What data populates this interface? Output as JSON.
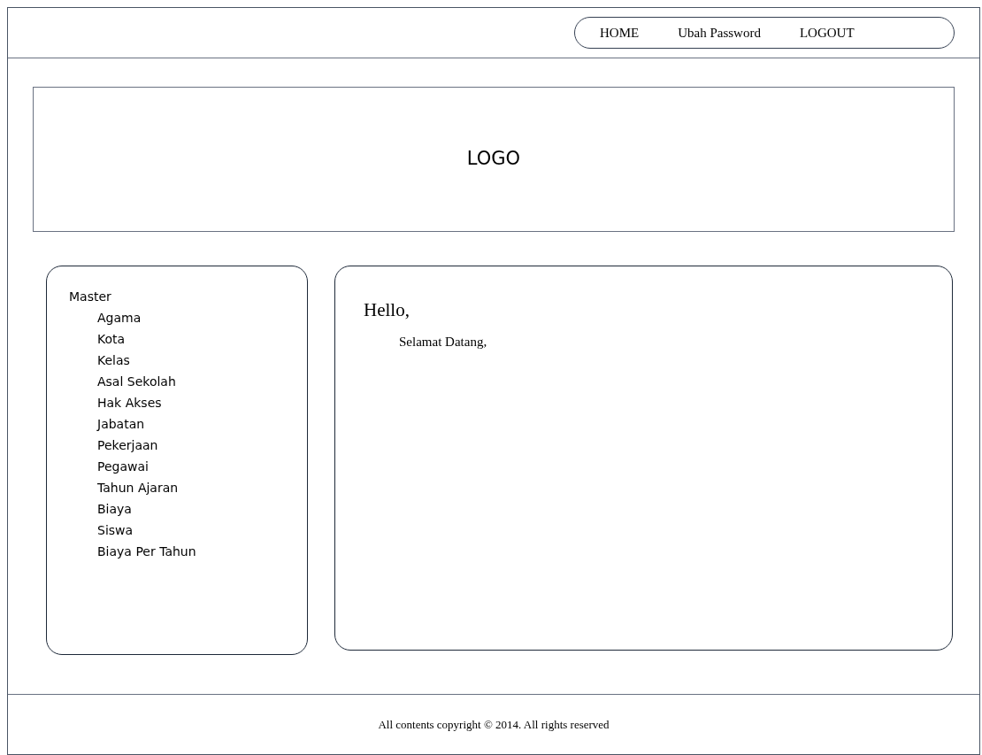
{
  "nav": [
    "HOME",
    "Ubah Password",
    "LOGOUT"
  ],
  "header": {
    "logo": "LOGO"
  },
  "sidebar": {
    "items": [
      {
        "label": "Master",
        "children": [
          {
            "label": "Agama"
          },
          {
            "label": "Kota"
          },
          {
            "label": "Kelas"
          },
          {
            "label": "Asal Sekolah"
          },
          {
            "label": "Hak Akses"
          },
          {
            "label": "Jabatan"
          },
          {
            "label": "Pekerjaan"
          },
          {
            "label": "Pegawai"
          },
          {
            "label": "Tahun Ajaran"
          },
          {
            "label": "Biaya"
          },
          {
            "label": "Siswa"
          },
          {
            "label": "Biaya Per Tahun"
          }
        ]
      }
    ]
  },
  "content": {
    "heading": "Hello,",
    "text": "Selamat Datang,"
  },
  "footer": "All contents copyright © 2014. All rights reserved"
}
